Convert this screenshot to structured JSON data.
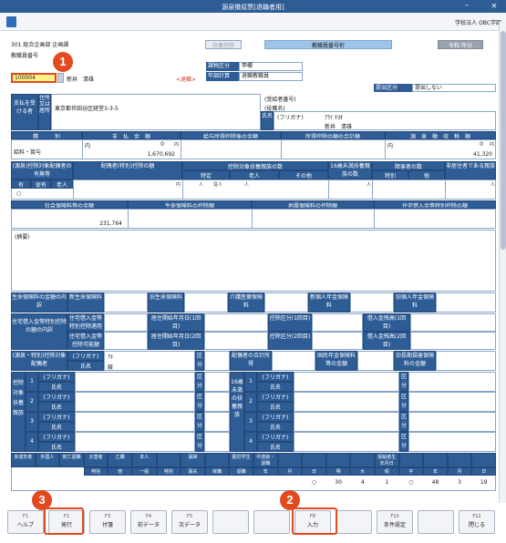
{
  "window": {
    "title": "源泉徴収票[退職者用]",
    "org": "学校法人 OBC学園"
  },
  "header": {
    "dept": "301 総合企画部 企画課",
    "emp_label": "教職員番号",
    "emp_id": "100004",
    "name": "新井　清雄",
    "status": "<退職>",
    "school_kbn_label": "課税区分",
    "school_kbn_value": "甲欄",
    "year_calc_label": "年調計算",
    "year_calc_value": "退職教職員",
    "tab_faded": "扶養控除",
    "teacher_no_label": "教職員番号桁",
    "year_label": "令和 年分",
    "submit_label": "提出区分",
    "submit_value": "提出しない"
  },
  "payee": {
    "side_label": "支払を受ける者",
    "addr_label": "住所又は居所",
    "address": "東京都世田谷区経堂3-3-5",
    "recv_no": "(受給者番号)",
    "role": "(役職名)",
    "name_label": "氏名",
    "furigana_label": "(フリガナ)",
    "furigana": "ｱﾗｲ ｷﾖｵ",
    "name": "新井　清雄"
  },
  "income": {
    "h_kind": "種　　　別",
    "h_pay": "支　払　金　額",
    "h_after": "給与所得控除後の金額",
    "h_deduct": "所得控除の額の合計額",
    "h_tax": "源　泉　徴　収　税　額",
    "kind": "給料・賞与",
    "inside": "内",
    "pay_top": "0",
    "pay": "1,670,692",
    "tax_top": "0",
    "tax": "41,320",
    "yen": "円"
  },
  "dependents": {
    "h1": "(源泉)控除対象配偶者の有無等",
    "h2": "配偶者(特別)控除の額",
    "h3": "控除対象扶養親族の数",
    "h4": "16歳未満扶養親族の数",
    "h5": "障害者の数",
    "h6": "非居住者である親族",
    "sub_tokutei": "特定",
    "sub_rojin": "老人",
    "sub_other": "その他",
    "sub_toku": "特別",
    "sub_ta": "他",
    "yes": "有",
    "juu": "従有",
    "old": "老人",
    "mark": "○",
    "nin": "人",
    "jyu": "従人"
  },
  "insurance": {
    "h1": "社会保険料等の金額",
    "h2": "生命保険料の控除額",
    "h3": "地震保険料の控除額",
    "h4": "住宅借入金等特別控除の額",
    "social": "231,764",
    "memo": "(摘要)"
  },
  "details": {
    "life_label": "生命保険料の金額の内訳",
    "new_life": "新生命保険料",
    "old_life": "旧生命保険料",
    "care": "介護医療保険料",
    "new_pension": "新個人年金保険料",
    "old_pension": "旧個人年金保険料",
    "housing_label": "住宅借入金等特別控除の額の内訳",
    "housing_applic": "住宅借入金等特別控除適用数",
    "housing_possible": "住宅借入金等控除可能額",
    "start1": "居住開始年月日(1回目)",
    "start2": "居住開始年月日(2回目)",
    "kbn1": "控除区分(1回目)",
    "kbn2": "控除区分(2回目)",
    "bal1": "借入金残高(1回目)",
    "bal2": "借入金残高(2回目)",
    "year": "年",
    "month": "月",
    "day": "日",
    "spouse_label": "(源泉・特別)控除対象配偶者",
    "spouse_furi": "(フリガナ)",
    "spouse_name": "氏名",
    "spouse_furi_val": "ｱｷ",
    "spouse_name_val": "綾",
    "kbn": "区分",
    "spouse_income": "配偶者の合計所得",
    "nat_pension": "国民年金保険料等の金額",
    "old_long": "旧長期損害保険料の金額"
  },
  "family": {
    "left_label": "控除対象扶養親族",
    "mid_label": "16歳未満の扶養親族",
    "nums": [
      "1",
      "2",
      "3",
      "4"
    ],
    "furi": "(フリガナ)",
    "shimei": "氏名",
    "kbn": "区分"
  },
  "bottom": {
    "headers": [
      "未成年者",
      "外国人",
      "死亡退職",
      "災害者",
      "乙欄",
      "本人",
      "",
      "寡婦",
      "",
      "勤労学生",
      "中途就・退職",
      "",
      "",
      "",
      "",
      "受給者生年月日",
      "",
      "",
      "",
      ""
    ],
    "sub": [
      "特別",
      "他",
      "一般",
      "特別",
      "寡夫",
      "就職",
      "退職",
      "年",
      "月",
      "日",
      "明",
      "大",
      "昭",
      "平",
      "年",
      "月",
      "日"
    ],
    "values": [
      "○",
      "30",
      "4",
      "1",
      "○",
      "48",
      "3",
      "19"
    ]
  },
  "fkeys": [
    {
      "key": "F1",
      "label": "ヘルプ"
    },
    {
      "key": "F2",
      "label": "発行"
    },
    {
      "key": "F3",
      "label": "付箋"
    },
    {
      "key": "F4",
      "label": "前データ"
    },
    {
      "key": "F5",
      "label": "次データ"
    },
    {
      "key": "",
      "label": ""
    },
    {
      "key": "",
      "label": ""
    },
    {
      "key": "F8",
      "label": "入力"
    },
    {
      "key": "",
      "label": ""
    },
    {
      "key": "F10",
      "label": "条件設定"
    },
    {
      "key": "",
      "label": ""
    },
    {
      "key": "F12",
      "label": "閉じる"
    }
  ],
  "badges": [
    "1",
    "2",
    "3"
  ],
  "colors": {
    "titlebar": "#2e5d96",
    "accent": "#e04a1e",
    "highlight": "#fff38c"
  }
}
